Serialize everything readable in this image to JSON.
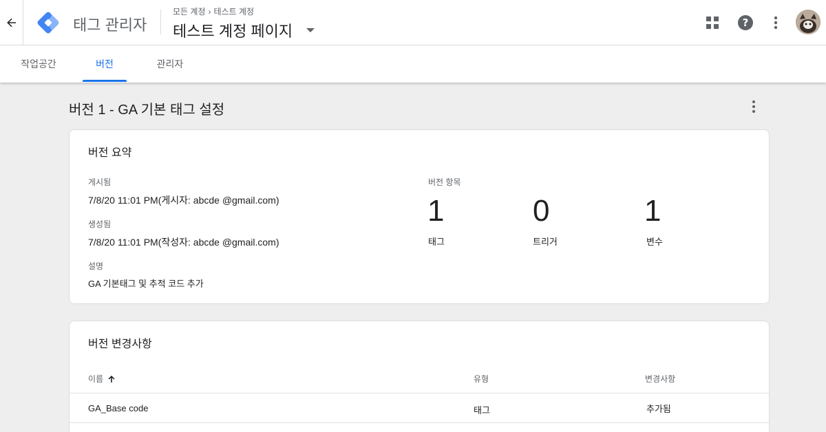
{
  "header": {
    "product_name": "태그 관리자",
    "breadcrumb": [
      "모든 계정",
      "테스트 계정"
    ],
    "container_name": "테스트 계정 페이지"
  },
  "tabs": [
    {
      "label": "작업공간",
      "active": false
    },
    {
      "label": "버전",
      "active": true
    },
    {
      "label": "관리자",
      "active": false
    }
  ],
  "page": {
    "title": "버전 1 - GA 기본 태그 설정"
  },
  "summary": {
    "title": "버전 요약",
    "published_label": "게시됨",
    "published_value": "7/8/20  11:01 PM(게시자: abcde @gmail.com)",
    "created_label": "생성됨",
    "created_value": "7/8/20  11:01 PM(작성자: abcde @gmail.com)",
    "description_label": "설명",
    "description_value": "GA 기본태그 및 추적 코드 추가",
    "items_label": "버전 항목",
    "stats": [
      {
        "count": "1",
        "label": "태그"
      },
      {
        "count": "0",
        "label": "트리거"
      },
      {
        "count": "1",
        "label": "변수"
      }
    ]
  },
  "changes": {
    "title": "버전 변경사항",
    "columns": {
      "name": "이름",
      "type": "유형",
      "change": "변경사항"
    },
    "rows": [
      {
        "name": "GA_Base code",
        "type": "태그",
        "change": "추가됨"
      }
    ]
  },
  "colors": {
    "accent": "#1a73e8",
    "logo_light": "#8ab4f8",
    "logo_dark": "#4285f4"
  },
  "icons": [
    "back-arrow-icon",
    "gtm-logo-icon",
    "chevron-right-icon",
    "caret-down-icon",
    "apps-grid-icon",
    "help-icon",
    "more-vert-icon",
    "arrow-upward-icon"
  ]
}
